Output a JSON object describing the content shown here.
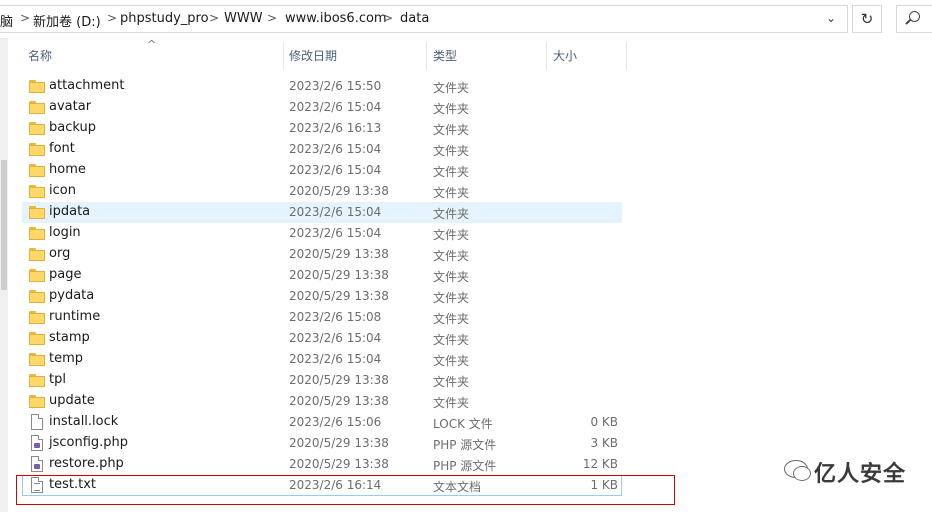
{
  "address_bar": {
    "path": [
      "脑",
      "新加卷 (D:)",
      "phpstudy_pro",
      "WWW",
      "www.ibos6.com",
      "data"
    ],
    "separator": ">",
    "dropdown_icon": "chevron-down-icon",
    "refresh_icon": "refresh-icon",
    "refresh_glyph": "↻",
    "search_icon": "search-icon"
  },
  "columns": {
    "name": "名称",
    "date": "修改日期",
    "type": "类型",
    "size": "大小"
  },
  "files": [
    {
      "name": "attachment",
      "date": "2023/2/6 15:50",
      "type": "文件夹",
      "size": "",
      "kind": "folder"
    },
    {
      "name": "avatar",
      "date": "2023/2/6 15:04",
      "type": "文件夹",
      "size": "",
      "kind": "folder"
    },
    {
      "name": "backup",
      "date": "2023/2/6 16:13",
      "type": "文件夹",
      "size": "",
      "kind": "folder"
    },
    {
      "name": "font",
      "date": "2023/2/6 15:04",
      "type": "文件夹",
      "size": "",
      "kind": "folder"
    },
    {
      "name": "home",
      "date": "2023/2/6 15:04",
      "type": "文件夹",
      "size": "",
      "kind": "folder"
    },
    {
      "name": "icon",
      "date": "2020/5/29 13:38",
      "type": "文件夹",
      "size": "",
      "kind": "folder"
    },
    {
      "name": "ipdata",
      "date": "2023/2/6 15:04",
      "type": "文件夹",
      "size": "",
      "kind": "folder",
      "hovered": true
    },
    {
      "name": "login",
      "date": "2023/2/6 15:04",
      "type": "文件夹",
      "size": "",
      "kind": "folder"
    },
    {
      "name": "org",
      "date": "2020/5/29 13:38",
      "type": "文件夹",
      "size": "",
      "kind": "folder"
    },
    {
      "name": "page",
      "date": "2020/5/29 13:38",
      "type": "文件夹",
      "size": "",
      "kind": "folder"
    },
    {
      "name": "pydata",
      "date": "2020/5/29 13:38",
      "type": "文件夹",
      "size": "",
      "kind": "folder"
    },
    {
      "name": "runtime",
      "date": "2023/2/6 15:08",
      "type": "文件夹",
      "size": "",
      "kind": "folder"
    },
    {
      "name": "stamp",
      "date": "2023/2/6 15:04",
      "type": "文件夹",
      "size": "",
      "kind": "folder"
    },
    {
      "name": "temp",
      "date": "2023/2/6 15:04",
      "type": "文件夹",
      "size": "",
      "kind": "folder"
    },
    {
      "name": "tpl",
      "date": "2020/5/29 13:38",
      "type": "文件夹",
      "size": "",
      "kind": "folder"
    },
    {
      "name": "update",
      "date": "2020/5/29 13:38",
      "type": "文件夹",
      "size": "",
      "kind": "folder"
    },
    {
      "name": "install.lock",
      "date": "2023/2/6 15:06",
      "type": "LOCK 文件",
      "size": "0 KB",
      "kind": "file"
    },
    {
      "name": "jsconfig.php",
      "date": "2020/5/29 13:38",
      "type": "PHP 源文件",
      "size": "3 KB",
      "kind": "php"
    },
    {
      "name": "restore.php",
      "date": "2020/5/29 13:38",
      "type": "PHP 源文件",
      "size": "12 KB",
      "kind": "php"
    },
    {
      "name": "test.txt",
      "date": "2023/2/6 16:14",
      "type": "文本文档",
      "size": "1 KB",
      "kind": "txt",
      "selected": true
    }
  ],
  "watermark": {
    "text": "亿人安全",
    "icon": "wechat-icon"
  },
  "colors": {
    "hover_row": "#e5f3ff",
    "highlight_box": "#d40000",
    "folder": "#ffd867"
  }
}
